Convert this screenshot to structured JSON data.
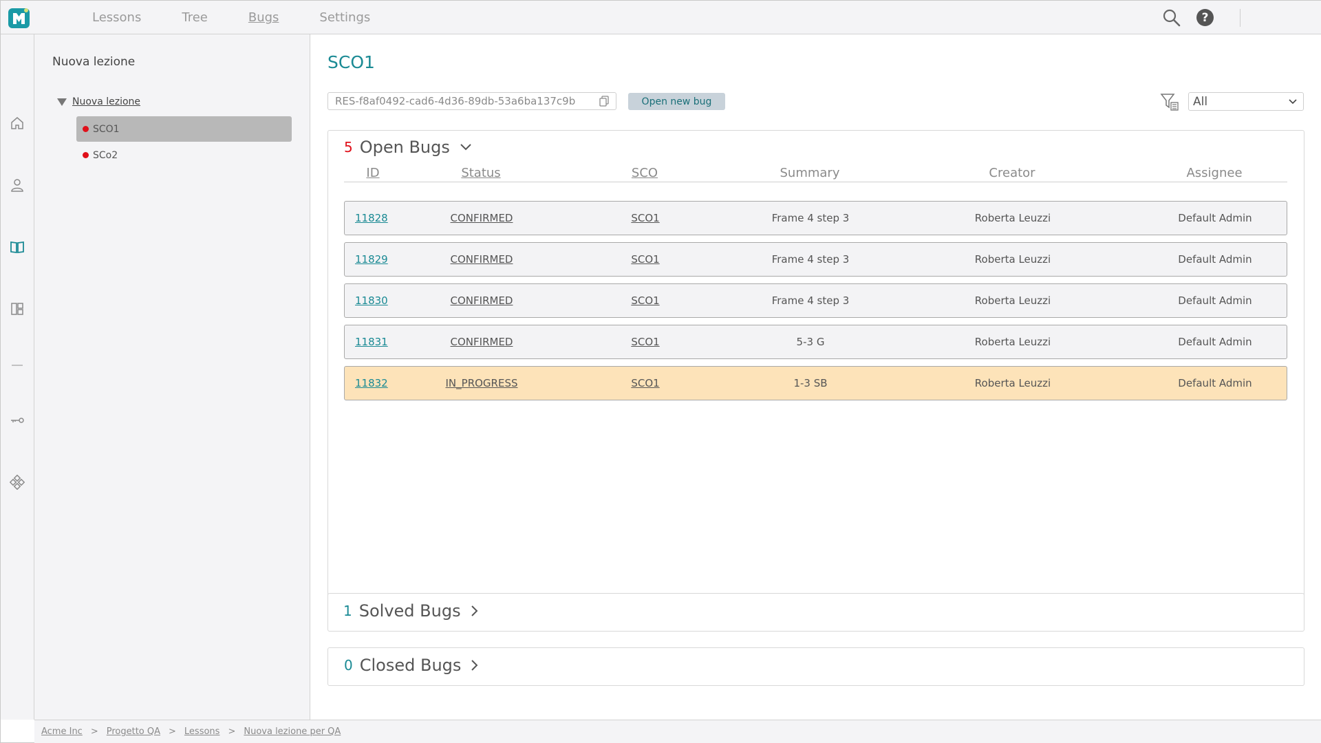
{
  "nav": {
    "items": [
      {
        "label": "Lessons",
        "active": false
      },
      {
        "label": "Tree",
        "active": false
      },
      {
        "label": "Bugs",
        "active": true
      },
      {
        "label": "Settings",
        "active": false
      }
    ],
    "help_label": "?"
  },
  "rail": {
    "icons": [
      "home-icon",
      "user-icon",
      "book-icon",
      "layout-icon",
      "minus-icon",
      "key-icon",
      "components-icon"
    ]
  },
  "tree": {
    "title": "Nuova lezione",
    "root_label": "Nuova lezione",
    "nodes": [
      {
        "label": "SCO1",
        "selected": true,
        "status_color": "#e0101a"
      },
      {
        "label": "SCo2",
        "selected": false,
        "status_color": "#e0101a"
      }
    ]
  },
  "main": {
    "title": "SCO1",
    "resource_id": "RES-f8af0492-cad6-4d36-89db-53a6ba137c9b",
    "open_bug_button": "Open new bug",
    "filter": {
      "selected": "All"
    }
  },
  "open_bugs": {
    "count": "5",
    "label": "Open Bugs",
    "columns": [
      "ID",
      "Status",
      "SCO",
      "Summary",
      "Creator",
      "Assignee"
    ],
    "rows": [
      {
        "id": "11828",
        "status": "CONFIRMED",
        "sco": "SCO1",
        "summary": "Frame 4 step 3",
        "creator": "Roberta Leuzzi",
        "assignee": "Default Admin"
      },
      {
        "id": "11829",
        "status": "CONFIRMED",
        "sco": "SCO1",
        "summary": "Frame 4 step 3",
        "creator": "Roberta Leuzzi",
        "assignee": "Default Admin"
      },
      {
        "id": "11830",
        "status": "CONFIRMED",
        "sco": "SCO1",
        "summary": "Frame 4 step 3",
        "creator": "Roberta Leuzzi",
        "assignee": "Default Admin"
      },
      {
        "id": "11831",
        "status": "CONFIRMED",
        "sco": "SCO1",
        "summary": "5-3 G",
        "creator": "Roberta Leuzzi",
        "assignee": "Default Admin"
      },
      {
        "id": "11832",
        "status": "IN_PROGRESS",
        "sco": "SCO1",
        "summary": "1-3 SB",
        "creator": "Roberta Leuzzi",
        "assignee": "Default Admin"
      }
    ]
  },
  "solved_bugs": {
    "count": "1",
    "label": "Solved Bugs"
  },
  "closed_bugs": {
    "count": "0",
    "label": "Closed Bugs"
  },
  "breadcrumb": [
    "Acme Inc",
    "Progetto QA",
    "Lessons",
    "Nuova lezione per QA"
  ],
  "colors": {
    "accent": "#1a8a94",
    "open_count": "#e0101a",
    "in_progress_row": "#fde3b9",
    "selected_node": "#b8b8b8"
  }
}
